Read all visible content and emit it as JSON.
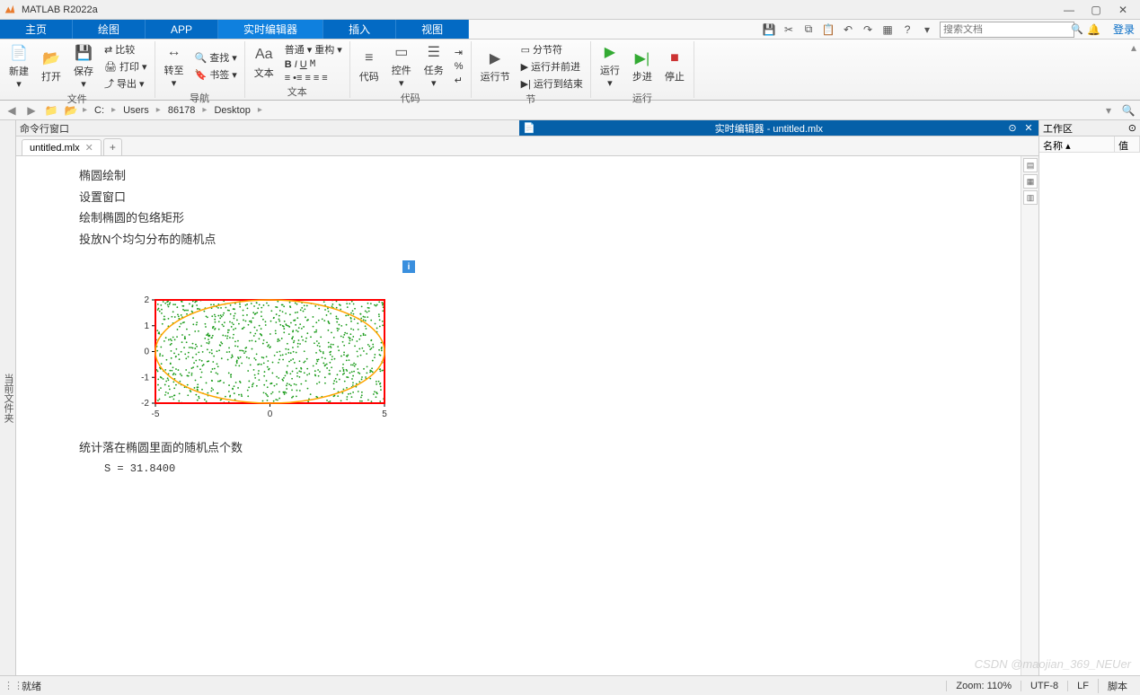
{
  "title": "MATLAB R2022a",
  "main_tabs": [
    "主页",
    "绘图",
    "APP",
    "实时编辑器",
    "插入",
    "视图"
  ],
  "active_tab_index": 3,
  "search_placeholder": "搜索文档",
  "login_text": "登录",
  "toolstrip": {
    "file": {
      "new": "新建",
      "open": "打开",
      "save": "保存",
      "compare": "比较",
      "print": "打印",
      "export": "导出",
      "label": "文件"
    },
    "nav": {
      "goto": "转至",
      "find": "查找",
      "bookmark": "书签",
      "label": "导航"
    },
    "text": {
      "btn": "文本",
      "normal": "普通",
      "refactor": "重构",
      "label": "文本"
    },
    "code_insert": {
      "code": "代码",
      "control": "控件",
      "task": "任务",
      "label": "代码"
    },
    "section": {
      "section_break": "分节符",
      "run_advance": "运行并前进",
      "run_to_end": "运行到结束",
      "run_section": "运行节",
      "label": "节"
    },
    "run": {
      "run": "运行",
      "step": "步进",
      "stop": "停止",
      "label": "运行"
    }
  },
  "address_bar": [
    "C:",
    "Users",
    "86178",
    "Desktop"
  ],
  "cmd_window_label": "命令行窗口",
  "editor_title": "实时编辑器 - untitled.mlx",
  "file_tab": "untitled.mlx",
  "editor_lines": [
    "椭圆绘制",
    "设置窗口",
    "绘制椭圆的包络矩形",
    "投放N个均匀分布的随机点"
  ],
  "editor_line_after": "统计落在椭圆里面的随机点个数",
  "output_text": "S = 31.8400",
  "workspace": {
    "title": "工作区",
    "col_name": "名称",
    "col_val": "值"
  },
  "status": {
    "ready": "就绪",
    "zoom": "Zoom: 110%",
    "encoding": "UTF-8",
    "eol": "LF",
    "type": "脚本"
  },
  "watermark": "CSDN @maojian_369_NEUer",
  "chart_data": {
    "type": "scatter",
    "title": "",
    "xlim": [
      -5,
      5
    ],
    "ylim": [
      -2,
      2
    ],
    "xticks": [
      -5,
      0,
      5
    ],
    "yticks": [
      -2,
      -1,
      0,
      1,
      2
    ],
    "shapes": [
      {
        "type": "rectangle",
        "x0": -5,
        "y0": -2,
        "x1": 5,
        "y1": 2,
        "color": "red",
        "linewidth": 2
      },
      {
        "type": "ellipse",
        "cx": 0,
        "cy": 0,
        "rx": 5,
        "ry": 2,
        "color": "orange",
        "linewidth": 1.5
      }
    ],
    "series": [
      {
        "name": "random points",
        "color": "green",
        "n": 1000,
        "distribution": "uniform",
        "x_range": [
          -5,
          5
        ],
        "y_range": [
          -2,
          2
        ]
      }
    ],
    "note": "Points uniformly distributed; ~786 expected inside ellipse (π/4 fraction), area estimate S ≈ 31.84"
  }
}
